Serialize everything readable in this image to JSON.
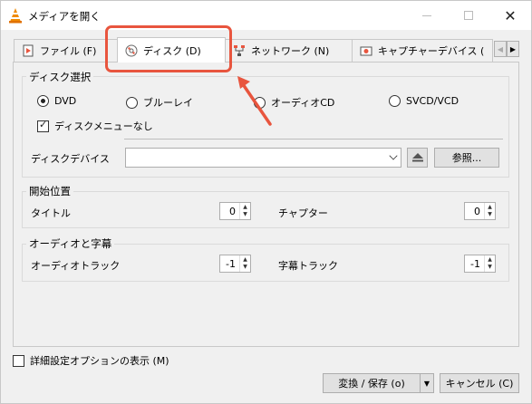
{
  "window": {
    "title": "メディアを開く",
    "controls": {
      "minimize": "minimize",
      "maximize": "maximize",
      "close": "✕"
    }
  },
  "tabs": [
    {
      "label": "ファイル (F)",
      "icon": "file-icon"
    },
    {
      "label": "ディスク (D)",
      "icon": "disc-icon",
      "active": true
    },
    {
      "label": "ネットワーク (N)",
      "icon": "network-icon"
    },
    {
      "label": "キャプチャーデバイス (",
      "icon": "capture-icon"
    }
  ],
  "disc_selection": {
    "title": "ディスク選択",
    "options": [
      {
        "label": "DVD",
        "checked": true
      },
      {
        "label": "ブルーレイ",
        "checked": false
      },
      {
        "label": "オーディオCD",
        "checked": false
      },
      {
        "label": "SVCD/VCD",
        "checked": false
      }
    ],
    "no_menu_label": "ディスクメニューなし",
    "no_menu_checked": true,
    "device_label": "ディスクデバイス",
    "device_value": "",
    "browse_label": "参照..."
  },
  "start_position": {
    "title": "開始位置",
    "title_label": "タイトル",
    "title_value": "0",
    "chapter_label": "チャプター",
    "chapter_value": "0"
  },
  "audio_subs": {
    "title": "オーディオと字幕",
    "audio_track_label": "オーディオトラック",
    "audio_track_value": "-1",
    "subtitle_track_label": "字幕トラック",
    "subtitle_track_value": "-1"
  },
  "footer": {
    "advanced_label": "詳細設定オプションの表示 (M)",
    "advanced_checked": false,
    "convert_label": "変換 / 保存 (o)",
    "cancel_label": "キャンセル (C)"
  },
  "colors": {
    "highlight": "#e8553e",
    "vlc_orange": "#f08a00"
  }
}
